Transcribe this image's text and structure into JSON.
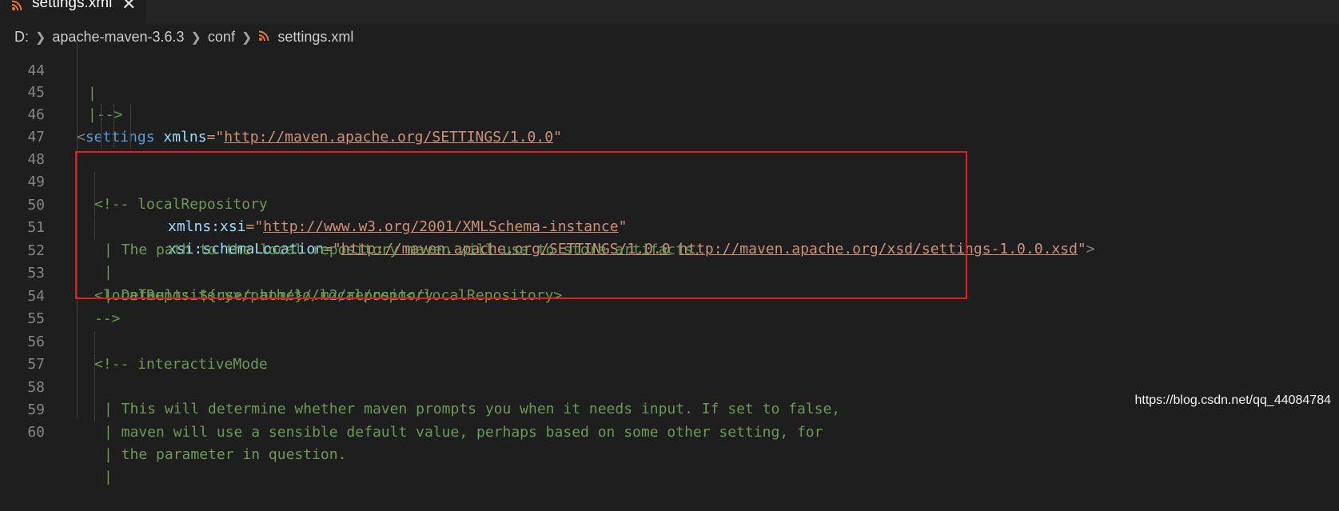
{
  "tab": {
    "filename": "settings.xml",
    "close_glyph": "✕",
    "icon": "rss-icon"
  },
  "breadcrumb": {
    "items": [
      "D:",
      "apache-maven-3.6.3",
      "conf",
      "settings.xml"
    ]
  },
  "editor": {
    "lines": [
      {
        "num": "44",
        "text": "|"
      },
      {
        "num": "45",
        "text": "|-->"
      },
      {
        "num": "46",
        "text": "<settings xmlns=\"http://maven.apache.org/SETTINGS/1.0.0\""
      },
      {
        "num": "47",
        "text": "xmlns:xsi=\"http://www.w3.org/2001/XMLSchema-instance\""
      },
      {
        "num": "48",
        "text": "xsi:schemaLocation=\"http://maven.apache.org/SETTINGS/1.0.0 http://maven.apache.org/xsd/settings-1.0.0.xsd\">"
      },
      {
        "num": "49",
        "text": "<!-- localRepository"
      },
      {
        "num": "50",
        "text": "| The path to the local repository maven will use to store artifacts."
      },
      {
        "num": "51",
        "text": "|"
      },
      {
        "num": "52",
        "text": "| Default: ${user.home}/.m2/repository"
      },
      {
        "num": "53",
        "text": "<localRepository>/path/to/local/repo</localRepository>"
      },
      {
        "num": "54",
        "text": "-->"
      },
      {
        "num": "55",
        "text": ""
      },
      {
        "num": "56",
        "text": "<!-- interactiveMode"
      },
      {
        "num": "57",
        "text": "| This will determine whether maven prompts you when it needs input. If set to false,"
      },
      {
        "num": "58",
        "text": "| maven will use a sensible default value, perhaps based on some other setting, for"
      },
      {
        "num": "59",
        "text": "| the parameter in question."
      },
      {
        "num": "60",
        "text": "|"
      }
    ],
    "tokens": {
      "settings_open": "<",
      "settings_tag": "settings",
      "xmlns_attr": "xmlns",
      "eq": "=",
      "xmlns_val": "http://maven.apache.org/SETTINGS/1.0.0",
      "xmlns_xsi_attr": "xmlns:xsi",
      "xmlns_xsi_val": "http://www.w3.org/2001/XMLSchema-instance",
      "schema_attr": "xsi:schemaLocation",
      "schema_val_1": "http://maven.apache.org/SETTINGS/1.0.0",
      "schema_val_2": "http://maven.apache.org/xsd/settings-1.0.0.xsd",
      "quote": "\"",
      "close": ">"
    }
  },
  "colors": {
    "background": "#1e1e1e",
    "highlight_box": "#e02020",
    "comment": "#6a9955",
    "tag": "#569cd6",
    "attr": "#9cdcfe",
    "string": "#ce9178"
  },
  "watermark": "https://blog.csdn.net/qq_44084784"
}
